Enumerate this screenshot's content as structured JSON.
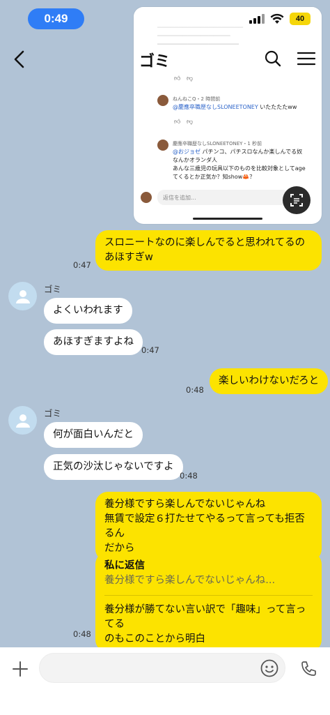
{
  "status": {
    "time": "0:49",
    "battery": "40"
  },
  "header": {
    "title": "ゴミ"
  },
  "screenshot": {
    "comment1_meta": "ねんねこQ・2 時間前",
    "comment1_mention": "@慶應卒職歴なしSLONEETONEY",
    "comment1_text": "いたたたたww",
    "comment2_meta": "慶應卒職歴なしSLONEETONEY・1 秒前",
    "comment2_mention": "@おジョゼ",
    "comment2_line1": "パチンコ、パチスロなんか楽しんでる奴",
    "comment2_line2": "なんかオランダ人",
    "comment2_line3": "あんな三歳児の玩具以下のものを比較対象としてage",
    "comment2_line4": "てくるとか正気か？知show🦀？",
    "reply_placeholder": "返信を追加..."
  },
  "messages": [
    {
      "id": "m1",
      "side": "out",
      "text": "スロニートなのに楽しんでると思われてるのあほすぎw",
      "time": "0:47"
    },
    {
      "id": "m2",
      "side": "in",
      "sender": "ゴミ",
      "text": "よくいわれます"
    },
    {
      "id": "m3",
      "side": "in",
      "text": "あほすぎますよね",
      "time": "0:47"
    },
    {
      "id": "m4",
      "side": "out",
      "text": "楽しいわけないだろと",
      "time": "0:48"
    },
    {
      "id": "m5",
      "side": "in",
      "sender": "ゴミ",
      "text": "何が面白いんだと"
    },
    {
      "id": "m6",
      "side": "in",
      "text": "正気の沙汰じゃないですよ",
      "time": "0:48"
    },
    {
      "id": "m7",
      "side": "out",
      "line1": "養分様ですら楽しんでないじゃんね",
      "line2": "無賃で設定６打たせてやるって言っても拒否るん",
      "line3": "だから"
    },
    {
      "id": "m8",
      "side": "out",
      "reply_title": "私に返信",
      "reply_quote": "養分様ですら楽しんでないじゃんね...",
      "line1": "養分様が勝てない言い訳で「趣味」って言ってる",
      "line2": "のもこのことから明白",
      "time": "0:48"
    }
  ],
  "colors": {
    "background": "#b1c3d6",
    "outgoing": "#fce300",
    "incoming": "#ffffff",
    "time_pill": "#2f7df6"
  }
}
